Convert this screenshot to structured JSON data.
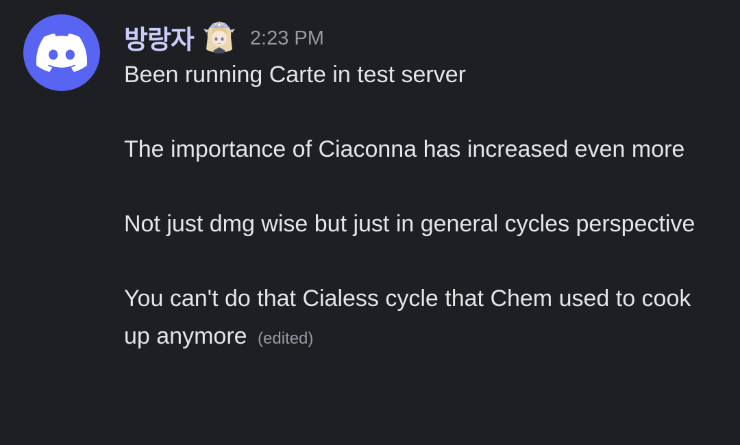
{
  "message": {
    "avatar_icon": "discord-logo-icon",
    "avatar_color": "#5865f2",
    "username": "방랑자",
    "username_color": "#c9cdfb",
    "role_icon": "character-portrait-icon",
    "timestamp": "2:23 PM",
    "paragraphs": [
      "Been running Carte in test server",
      "The importance of Ciaconna has increased even more",
      "Not just dmg wise but just in general cycles perspective",
      "You can't do that Cialess cycle that Chem used to cook up anymore"
    ],
    "edited_label": "(edited)"
  }
}
